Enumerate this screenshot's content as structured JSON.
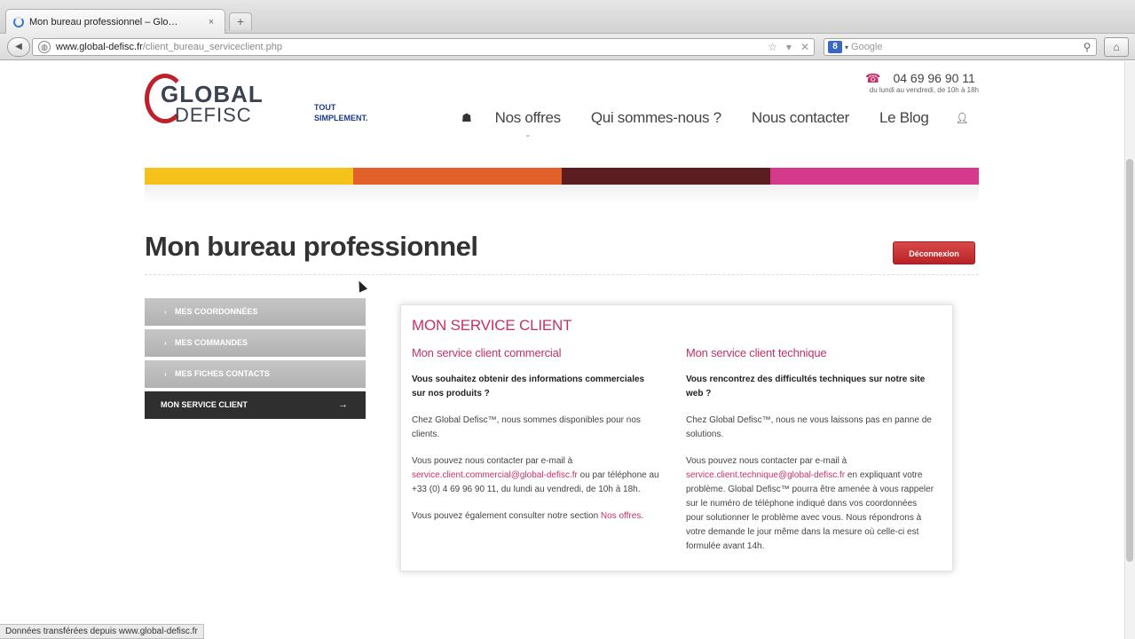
{
  "browser": {
    "tab_title": "Mon bureau professionnel – Glo…",
    "tab_close": "×",
    "new_tab": "+",
    "back": "◀",
    "url_host": "www.global-defisc.fr",
    "url_path": "/client_bureau_serviceclient.php",
    "search_engine_icon": "8",
    "search_placeholder": "Google",
    "home": "⌂",
    "status_text": "Données transférées depuis www.global-defisc.fr"
  },
  "header": {
    "logo_line1": "GLOBAL",
    "logo_line2": "DEFISC",
    "tagline_line1": "TOUT",
    "tagline_line2": "SIMPLEMENT.",
    "phone": "04 69 96 90 11",
    "hours": "du lundi au vendredi, de 10h à 18h"
  },
  "nav": {
    "home_icon": "home-icon",
    "items": [
      "Nos offres",
      "Qui sommes-nous ?",
      "Nous contacter",
      "Le Blog"
    ],
    "user_icon": "user-icon"
  },
  "colors": {
    "bar": [
      "#f4c21a",
      "#e2612a",
      "#5b1d1f",
      "#d5398b"
    ],
    "accent": "#c4306b",
    "logout": "#c62a2f"
  },
  "page": {
    "title": "Mon bureau professionnel",
    "logout_label": "Déconnexion"
  },
  "sidebar": {
    "items": [
      {
        "label": "MES COORDONNÉES"
      },
      {
        "label": "MES COMMANDES"
      },
      {
        "label": "MES FICHES CONTACTS"
      },
      {
        "label": "MON SERVICE CLIENT"
      }
    ]
  },
  "service": {
    "title": "MON SERVICE CLIENT",
    "commercial": {
      "heading": "Mon service client commercial",
      "question": "Vous souhaitez obtenir des informations commerciales sur nos produits ?",
      "p1": "Chez Global Defisc™, nous sommes disponibles pour nos clients.",
      "p2_before": "Vous pouvez nous contacter par e-mail à",
      "p2_email": "service.client.commercial@global-defisc.fr",
      "p2_after": "ou par téléphone au +33 (0) 4 69 96 90 11, du lundi au vendredi, de 10h à 18h.",
      "p3_before": "Vous pouvez également consulter notre section",
      "p3_link": "Nos offres",
      "p3_after": "."
    },
    "technique": {
      "heading": "Mon service client technique",
      "question": "Vous rencontrez des difficultés techniques sur notre site web ?",
      "p1": "Chez Global Defisc™, nous ne vous laissons pas en panne de solutions.",
      "p2_before": "Vous pouvez nous contacter par e-mail à",
      "p2_email": "service.client.technique@global-defisc.fr",
      "p2_after": "en expliquant votre problème. Global Defisc™ pourra être amenée à vous rappeler sur le numéro de téléphone indiqué dans vos coordonnées pour solutionner le problème avec vous. Nous répondrons à votre demande le jour même dans la mesure où celle-ci est formulée avant 14h."
    }
  }
}
